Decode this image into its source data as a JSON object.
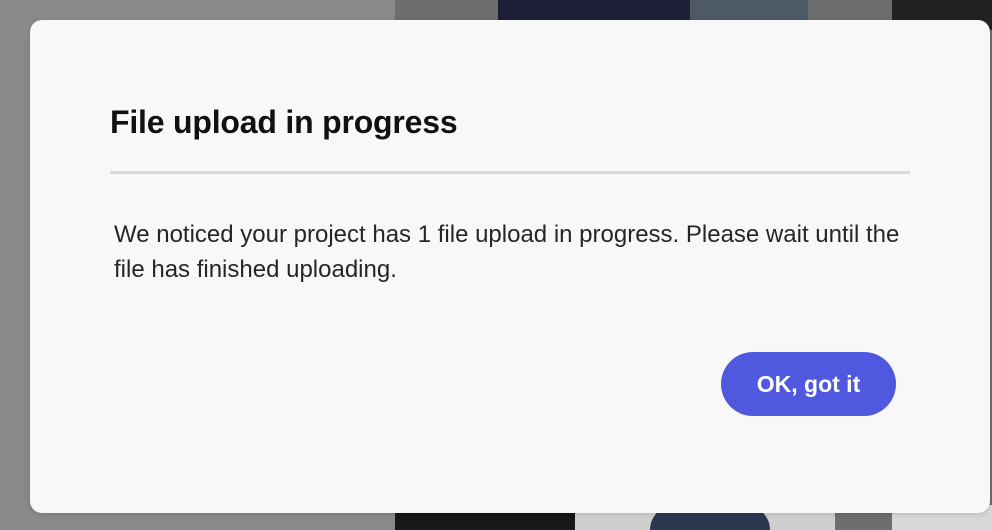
{
  "dialog": {
    "title": "File upload in progress",
    "message": "We noticed your project has 1 file upload in progress. Please wait until the file has finished uploading.",
    "confirm_label": "OK, got it"
  },
  "colors": {
    "overlay": "#8a8a8a",
    "dialog_background": "#f8f8f8",
    "divider": "#d9d9d9",
    "button_accent": "#5058e0",
    "button_text": "#ffffff",
    "title_text": "#111111",
    "body_text": "#262626"
  }
}
